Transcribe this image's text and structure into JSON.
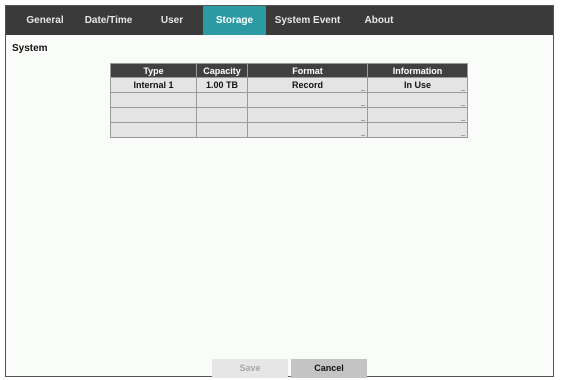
{
  "tabs": [
    {
      "label": "General"
    },
    {
      "label": "Date/Time"
    },
    {
      "label": "User"
    },
    {
      "label": "Storage",
      "active": true
    },
    {
      "label": "System Event"
    },
    {
      "label": "About"
    }
  ],
  "section": {
    "title": "System"
  },
  "table": {
    "columns": [
      "Type",
      "Capacity",
      "Format",
      "Information"
    ],
    "rows": [
      {
        "type": "Internal 1",
        "capacity": "1.00 TB",
        "format": "Record",
        "information": "In Use"
      },
      {
        "type": "",
        "capacity": "",
        "format": "",
        "information": ""
      },
      {
        "type": "",
        "capacity": "",
        "format": "",
        "information": ""
      },
      {
        "type": "",
        "capacity": "",
        "format": "",
        "information": ""
      }
    ]
  },
  "buttons": {
    "save": "Save",
    "cancel": "Cancel"
  },
  "colors": {
    "tabbar": "#3a3a3a",
    "active_tab": "#2b9aa2",
    "header": "#404040"
  }
}
